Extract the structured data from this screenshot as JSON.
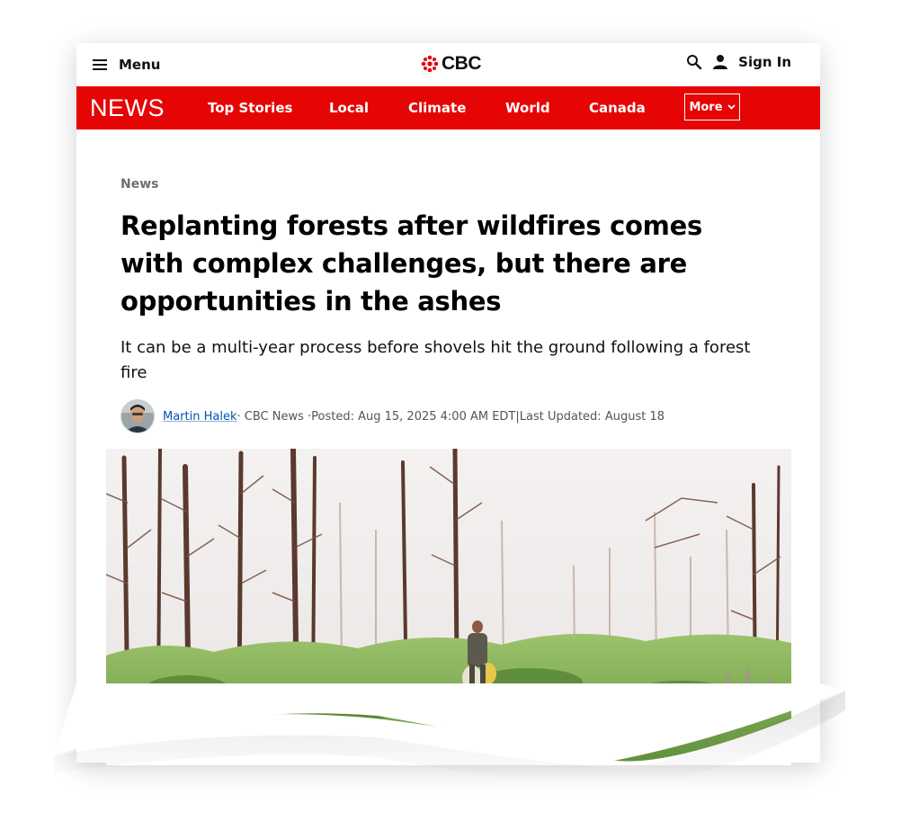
{
  "header": {
    "menu_label": "Menu",
    "logo_text": "CBC",
    "signin_label": "Sign In"
  },
  "nav": {
    "section_logo": "NEWS",
    "items": [
      {
        "label": "Top Stories"
      },
      {
        "label": "Local"
      },
      {
        "label": "Climate"
      },
      {
        "label": "World"
      },
      {
        "label": "Canada"
      }
    ],
    "more_label": "More"
  },
  "article": {
    "category": "News",
    "headline": "Replanting forests after wildfires comes with complex challenges, but there are opportunities in the ashes",
    "deck": "It can be a multi-year process before shovels hit the ground following a forest fire",
    "byline": {
      "author": "Martin Halek",
      "outlet": " · CBC News · ",
      "posted": "Posted: Aug 15, 2025 4:00 AM EDT",
      "separator": " | ",
      "updated": "Last Updated: August 18"
    }
  },
  "colors": {
    "brand_red": "#e60505",
    "link_blue": "#0053b3"
  }
}
